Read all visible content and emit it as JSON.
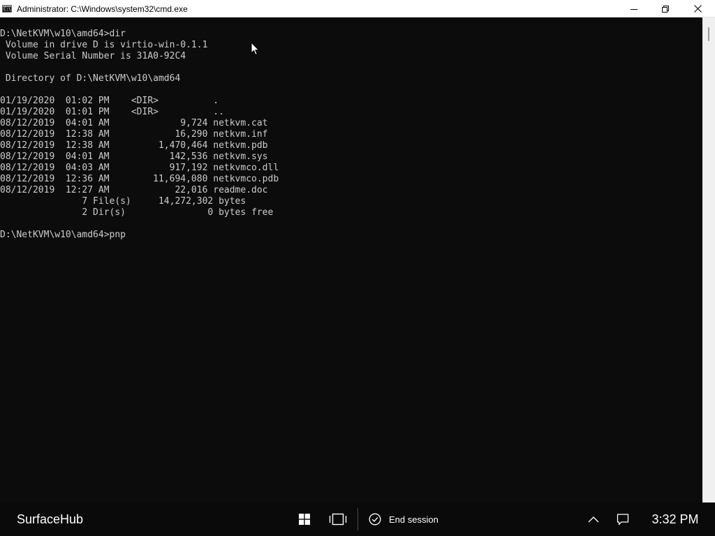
{
  "window": {
    "title": "Administrator: C:\\Windows\\system32\\cmd.exe",
    "icon": "cmd-icon",
    "icon_text": "C:\\",
    "controls": [
      "minimize-icon",
      "restore-icon",
      "close-icon"
    ]
  },
  "console": {
    "foreground": "#cccccc",
    "background": "#0c0c0c",
    "lines": [
      "D:\\NetKVM\\w10\\amd64>dir",
      " Volume in drive D is virtio-win-0.1.1",
      " Volume Serial Number is 31A0-92C4",
      "",
      " Directory of D:\\NetKVM\\w10\\amd64",
      "",
      "01/19/2020  01:02 PM    <DIR>          .",
      "01/19/2020  01:01 PM    <DIR>          ..",
      "08/12/2019  04:01 AM             9,724 netkvm.cat",
      "08/12/2019  12:38 AM            16,290 netkvm.inf",
      "08/12/2019  12:38 AM         1,470,464 netkvm.pdb",
      "08/12/2019  04:01 AM           142,536 netkvm.sys",
      "08/12/2019  04:03 AM           917,192 netkvmco.dll",
      "08/12/2019  12:36 AM        11,694,080 netkvmco.pdb",
      "08/12/2019  12:27 AM            22,016 readme.doc",
      "               7 File(s)     14,272,302 bytes",
      "               2 Dir(s)               0 bytes free",
      "",
      "D:\\NetKVM\\w10\\amd64>pnp"
    ]
  },
  "taskbar": {
    "device_name": "SurfaceHub",
    "start_icon": "windows-start-icon",
    "task_view_icon": "task-view-icon",
    "end_session_icon": "check-circle-icon",
    "end_session_label": "End session",
    "tray_chevron_icon": "chevron-up-icon",
    "notifications_icon": "notification-icon",
    "clock": "3:32 PM"
  }
}
